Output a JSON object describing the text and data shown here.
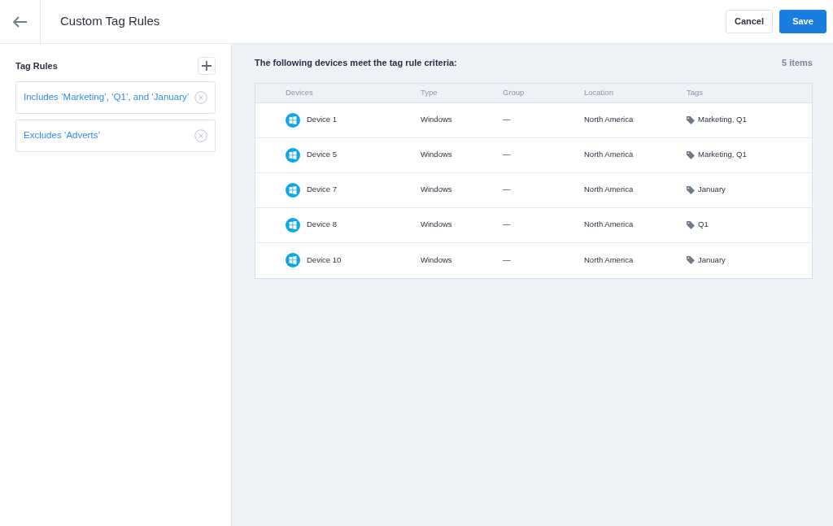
{
  "header": {
    "title": "Custom Tag Rules",
    "buttons": [
      {
        "label": "Cancel",
        "kind": "secondary"
      },
      {
        "label": "Save",
        "kind": "primary"
      }
    ]
  },
  "sidebar": {
    "title": "Tag Rules",
    "rules": [
      {
        "text": "Includes ‘Marketing’, ‘Q1’, and ‘January’"
      },
      {
        "text": "Excludes ‘Adverts’"
      }
    ]
  },
  "results": {
    "heading": "The following devices meet the tag rule criteria:",
    "count": "5 items",
    "table": {
      "columns": [
        "Devices",
        "Type",
        "Group",
        "Location",
        "Tags"
      ],
      "rows": [
        {
          "device": "Device 1",
          "type": "Windows",
          "group": "—",
          "location": "North America",
          "tags": "Marketing, Q1"
        },
        {
          "device": "Device 5",
          "type": "Windows",
          "group": "—",
          "location": "North America",
          "tags": "Marketing, Q1"
        },
        {
          "device": "Device 7",
          "type": "Windows",
          "group": "—",
          "location": "North America",
          "tags": "January"
        },
        {
          "device": "Device 8",
          "type": "Windows",
          "group": "—",
          "location": "North America",
          "tags": "Q1"
        },
        {
          "device": "Device 10",
          "type": "Windows",
          "group": "—",
          "location": "North America",
          "tags": "January"
        }
      ]
    }
  }
}
